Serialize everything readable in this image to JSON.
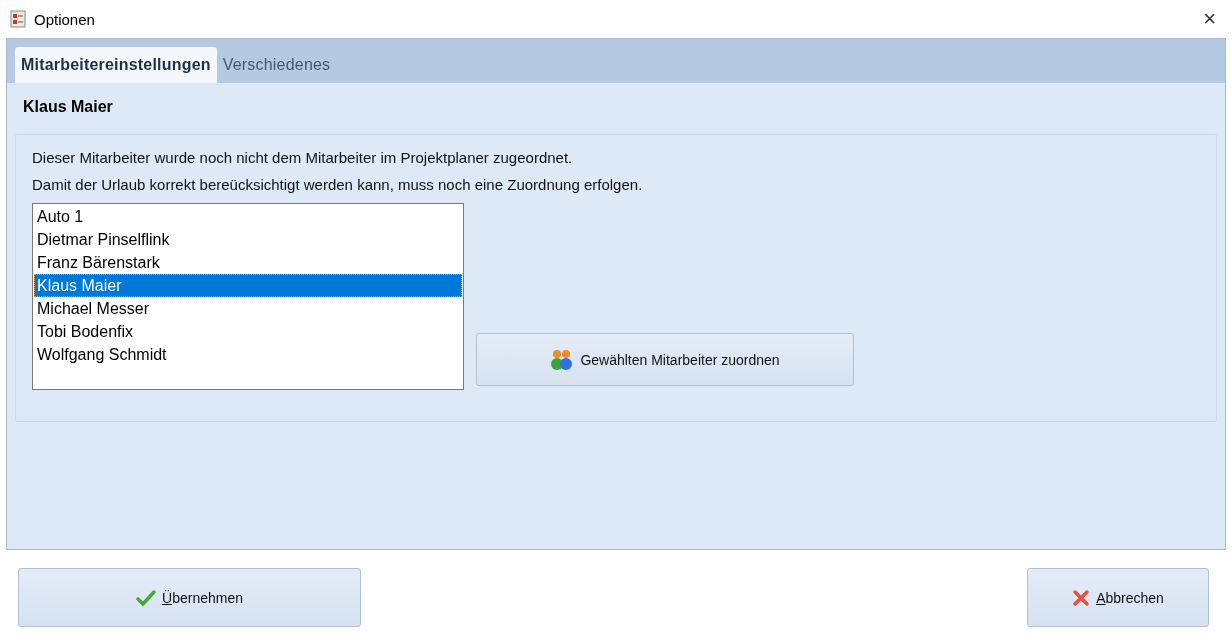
{
  "window": {
    "title": "Optionen",
    "close": "×"
  },
  "tabs": [
    {
      "label": "Mitarbeitereinstellungen",
      "selected": true
    },
    {
      "label": "Verschiedenes",
      "selected": false
    }
  ],
  "employee_name": "Klaus Maier",
  "messages": [
    "Dieser Mitarbeiter wurde noch nicht dem Mitarbeiter im Projektplaner zugeordnet.",
    "Damit der Urlaub korrekt bereücksichtigt werden kann, muss noch eine Zuordnung erfolgen."
  ],
  "employees": [
    {
      "name": "Auto 1",
      "selected": false
    },
    {
      "name": "Dietmar Pinselflink",
      "selected": false
    },
    {
      "name": "Franz Bärenstark",
      "selected": false
    },
    {
      "name": "Klaus Maier",
      "selected": true
    },
    {
      "name": "Michael Messer",
      "selected": false
    },
    {
      "name": "Tobi Bodenfix",
      "selected": false
    },
    {
      "name": "Wolfgang Schmidt",
      "selected": false
    }
  ],
  "assign_button": "Gewählten Mitarbeiter zuordnen",
  "buttons": [
    {
      "kind": "apply",
      "label": "Übernehmen",
      "mnemonic": true
    },
    {
      "kind": "cancel",
      "label": "Abbrechen",
      "mnemonic": true
    }
  ]
}
